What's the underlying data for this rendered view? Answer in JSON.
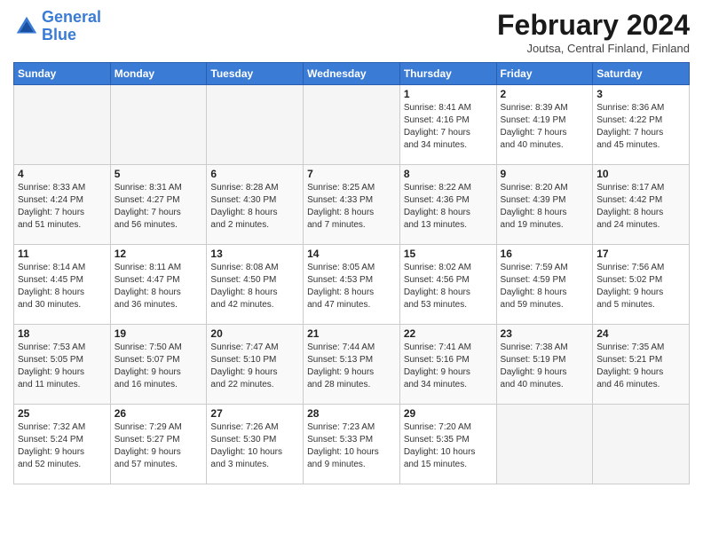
{
  "header": {
    "logo_line1": "General",
    "logo_line2": "Blue",
    "month": "February 2024",
    "location": "Joutsa, Central Finland, Finland"
  },
  "weekdays": [
    "Sunday",
    "Monday",
    "Tuesday",
    "Wednesday",
    "Thursday",
    "Friday",
    "Saturday"
  ],
  "weeks": [
    [
      {
        "day": "",
        "info": ""
      },
      {
        "day": "",
        "info": ""
      },
      {
        "day": "",
        "info": ""
      },
      {
        "day": "",
        "info": ""
      },
      {
        "day": "1",
        "info": "Sunrise: 8:41 AM\nSunset: 4:16 PM\nDaylight: 7 hours\nand 34 minutes."
      },
      {
        "day": "2",
        "info": "Sunrise: 8:39 AM\nSunset: 4:19 PM\nDaylight: 7 hours\nand 40 minutes."
      },
      {
        "day": "3",
        "info": "Sunrise: 8:36 AM\nSunset: 4:22 PM\nDaylight: 7 hours\nand 45 minutes."
      }
    ],
    [
      {
        "day": "4",
        "info": "Sunrise: 8:33 AM\nSunset: 4:24 PM\nDaylight: 7 hours\nand 51 minutes."
      },
      {
        "day": "5",
        "info": "Sunrise: 8:31 AM\nSunset: 4:27 PM\nDaylight: 7 hours\nand 56 minutes."
      },
      {
        "day": "6",
        "info": "Sunrise: 8:28 AM\nSunset: 4:30 PM\nDaylight: 8 hours\nand 2 minutes."
      },
      {
        "day": "7",
        "info": "Sunrise: 8:25 AM\nSunset: 4:33 PM\nDaylight: 8 hours\nand 7 minutes."
      },
      {
        "day": "8",
        "info": "Sunrise: 8:22 AM\nSunset: 4:36 PM\nDaylight: 8 hours\nand 13 minutes."
      },
      {
        "day": "9",
        "info": "Sunrise: 8:20 AM\nSunset: 4:39 PM\nDaylight: 8 hours\nand 19 minutes."
      },
      {
        "day": "10",
        "info": "Sunrise: 8:17 AM\nSunset: 4:42 PM\nDaylight: 8 hours\nand 24 minutes."
      }
    ],
    [
      {
        "day": "11",
        "info": "Sunrise: 8:14 AM\nSunset: 4:45 PM\nDaylight: 8 hours\nand 30 minutes."
      },
      {
        "day": "12",
        "info": "Sunrise: 8:11 AM\nSunset: 4:47 PM\nDaylight: 8 hours\nand 36 minutes."
      },
      {
        "day": "13",
        "info": "Sunrise: 8:08 AM\nSunset: 4:50 PM\nDaylight: 8 hours\nand 42 minutes."
      },
      {
        "day": "14",
        "info": "Sunrise: 8:05 AM\nSunset: 4:53 PM\nDaylight: 8 hours\nand 47 minutes."
      },
      {
        "day": "15",
        "info": "Sunrise: 8:02 AM\nSunset: 4:56 PM\nDaylight: 8 hours\nand 53 minutes."
      },
      {
        "day": "16",
        "info": "Sunrise: 7:59 AM\nSunset: 4:59 PM\nDaylight: 8 hours\nand 59 minutes."
      },
      {
        "day": "17",
        "info": "Sunrise: 7:56 AM\nSunset: 5:02 PM\nDaylight: 9 hours\nand 5 minutes."
      }
    ],
    [
      {
        "day": "18",
        "info": "Sunrise: 7:53 AM\nSunset: 5:05 PM\nDaylight: 9 hours\nand 11 minutes."
      },
      {
        "day": "19",
        "info": "Sunrise: 7:50 AM\nSunset: 5:07 PM\nDaylight: 9 hours\nand 16 minutes."
      },
      {
        "day": "20",
        "info": "Sunrise: 7:47 AM\nSunset: 5:10 PM\nDaylight: 9 hours\nand 22 minutes."
      },
      {
        "day": "21",
        "info": "Sunrise: 7:44 AM\nSunset: 5:13 PM\nDaylight: 9 hours\nand 28 minutes."
      },
      {
        "day": "22",
        "info": "Sunrise: 7:41 AM\nSunset: 5:16 PM\nDaylight: 9 hours\nand 34 minutes."
      },
      {
        "day": "23",
        "info": "Sunrise: 7:38 AM\nSunset: 5:19 PM\nDaylight: 9 hours\nand 40 minutes."
      },
      {
        "day": "24",
        "info": "Sunrise: 7:35 AM\nSunset: 5:21 PM\nDaylight: 9 hours\nand 46 minutes."
      }
    ],
    [
      {
        "day": "25",
        "info": "Sunrise: 7:32 AM\nSunset: 5:24 PM\nDaylight: 9 hours\nand 52 minutes."
      },
      {
        "day": "26",
        "info": "Sunrise: 7:29 AM\nSunset: 5:27 PM\nDaylight: 9 hours\nand 57 minutes."
      },
      {
        "day": "27",
        "info": "Sunrise: 7:26 AM\nSunset: 5:30 PM\nDaylight: 10 hours\nand 3 minutes."
      },
      {
        "day": "28",
        "info": "Sunrise: 7:23 AM\nSunset: 5:33 PM\nDaylight: 10 hours\nand 9 minutes."
      },
      {
        "day": "29",
        "info": "Sunrise: 7:20 AM\nSunset: 5:35 PM\nDaylight: 10 hours\nand 15 minutes."
      },
      {
        "day": "",
        "info": ""
      },
      {
        "day": "",
        "info": ""
      }
    ]
  ]
}
